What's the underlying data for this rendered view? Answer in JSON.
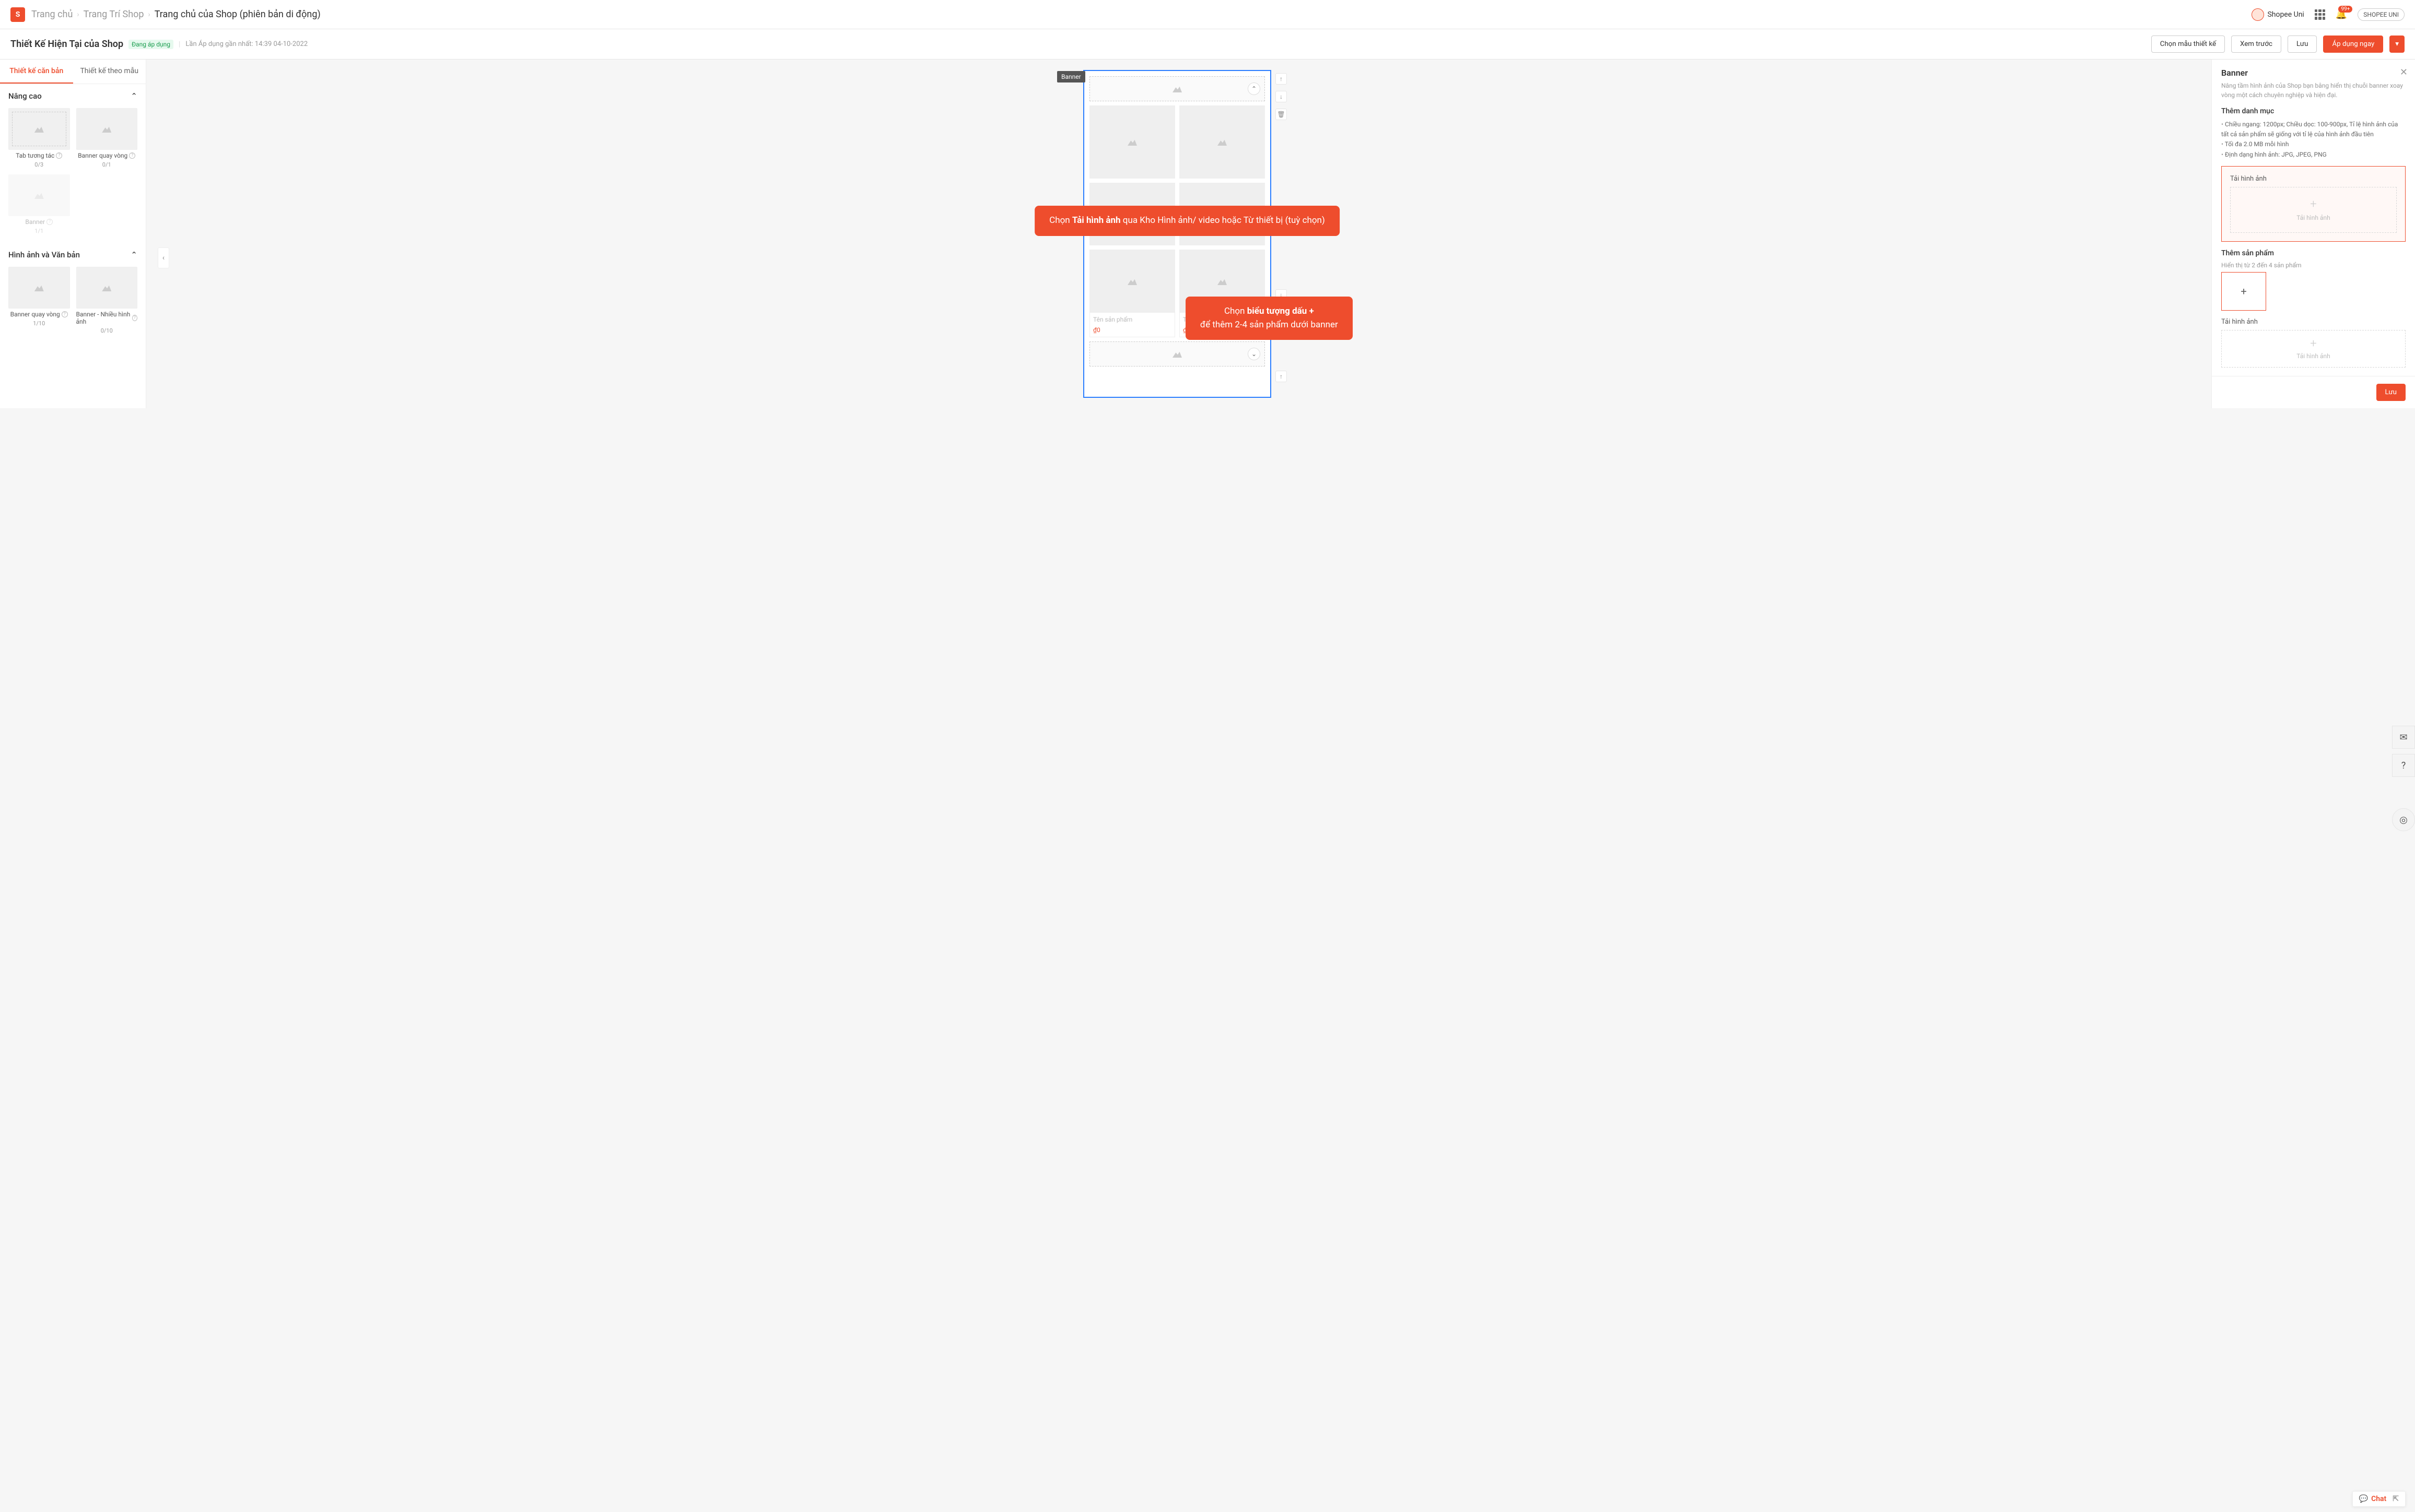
{
  "topbar": {
    "breadcrumb": [
      "Trang chủ",
      "Trang Trí Shop",
      "Trang chủ của Shop (phiên bản di động)"
    ],
    "uni_label": "Shopee Uni",
    "notif_badge": "99+",
    "uni_button": "SHOPEE UNI"
  },
  "subbar": {
    "title": "Thiết Kế Hiện Tại của Shop",
    "status_tag": "Đang áp dụng",
    "last_applied": "Lần Áp dụng gần nhất: 14:39 04-10-2022",
    "choose_template": "Chọn mẫu thiết kế",
    "preview": "Xem trước",
    "save": "Lưu",
    "apply_now": "Áp dụng ngay"
  },
  "sidebar": {
    "tab_basic": "Thiết kế căn bản",
    "tab_template": "Thiết kế theo mẫu",
    "section_advanced": "Nâng cao",
    "section_images": "Hình ảnh và Văn bản",
    "components": {
      "tab_interactive": {
        "name": "Tab tương tác",
        "count": "0/3"
      },
      "carousel": {
        "name": "Banner quay vòng",
        "count": "0/1"
      },
      "banner": {
        "name": "Banner",
        "count": "1/1"
      },
      "carousel2": {
        "name": "Banner quay vòng",
        "count": "1/10"
      },
      "multi_image": {
        "name": "Banner - Nhiều hình ảnh",
        "count": "0/10"
      }
    }
  },
  "canvas": {
    "element_label": "Banner",
    "product_name_placeholder": "Tên sản phẩm",
    "price": "₫0"
  },
  "callouts": {
    "c1_pre": "Chọn ",
    "c1_bold": "Tải hình ảnh",
    "c1_post": " qua Kho Hình ảnh/ video hoặc Từ thiết bị (tuỳ chọn)",
    "c2_pre": "Chọn ",
    "c2_bold": "biểu tượng dấu +",
    "c2_post": "để thêm 2-4 sản phẩm dưới banner"
  },
  "panel": {
    "title": "Banner",
    "desc": "Nâng tầm hình ảnh của Shop bạn bằng hiển thị chuỗi banner xoay vòng một cách chuyên nghiệp và hiện đại.",
    "add_category_title": "Thêm danh mục",
    "bullets": [
      "Chiều ngang: 1200px; Chiều dọc: 100-900px, Tỉ lệ hình ảnh của tất cả sản phẩm sẽ giống với tỉ lệ của hình ảnh đầu tiên",
      "Tối đa 2.0 MB mỗi hình",
      "Định dạng hình ảnh: JPG, JPEG, PNG"
    ],
    "upload_label": "Tải hình ảnh",
    "upload_action": "Tải hình ảnh",
    "add_product_title": "Thêm sản phẩm",
    "add_product_note": "Hiển thị từ 2 đến 4 sản phẩm",
    "save": "Lưu"
  },
  "chat": "Chat"
}
